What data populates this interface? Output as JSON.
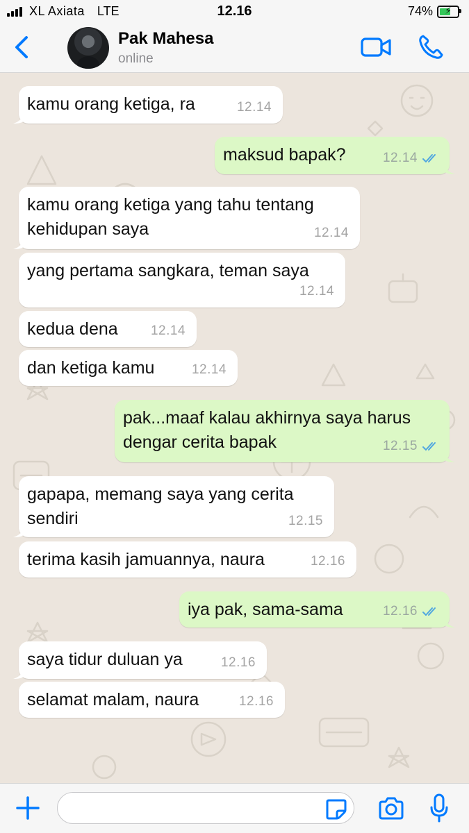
{
  "status_bar": {
    "carrier": "XL Axiata",
    "network": "LTE",
    "time": "12.16",
    "battery_text": "74%",
    "battery_level": 0.74
  },
  "header": {
    "back_icon": "chevron-left-icon",
    "contact_name": "Pak Mahesa",
    "contact_status": "online",
    "video_icon": "video-camera-icon",
    "call_icon": "phone-icon"
  },
  "messages": [
    {
      "direction": "in",
      "lines": [
        "kamu orang ketiga, ra"
      ],
      "time": "12.14"
    },
    {
      "direction": "out",
      "lines": [
        "maksud bapak?"
      ],
      "time": "12.14"
    },
    {
      "direction": "in",
      "lines": [
        "kamu orang ketiga yang tahu tentang",
        "kehidupan saya"
      ],
      "time": "12.14"
    },
    {
      "direction": "in",
      "lines": [
        "yang pertama sangkara, teman saya"
      ],
      "time": "12.14"
    },
    {
      "direction": "in",
      "lines": [
        "kedua dena"
      ],
      "time": "12.14"
    },
    {
      "direction": "in",
      "lines": [
        "dan ketiga kamu"
      ],
      "time": "12.14"
    },
    {
      "direction": "out",
      "lines": [
        "pak...maaf kalau akhirnya saya harus",
        "dengar cerita bapak"
      ],
      "time": "12.15"
    },
    {
      "direction": "in",
      "lines": [
        "gapapa, memang saya yang cerita",
        "sendiri"
      ],
      "time": "12.15"
    },
    {
      "direction": "in",
      "lines": [
        "terima kasih jamuannya, naura"
      ],
      "time": "12.16"
    },
    {
      "direction": "out",
      "lines": [
        "iya pak, sama-sama"
      ],
      "time": "12.16"
    },
    {
      "direction": "in",
      "lines": [
        "saya tidur duluan ya"
      ],
      "time": "12.16"
    },
    {
      "direction": "in",
      "lines": [
        "selamat malam, naura"
      ],
      "time": "12.16"
    }
  ],
  "input_bar": {
    "placeholder": "",
    "value": "",
    "icons": [
      "plus-icon",
      "sticker-icon",
      "camera-icon",
      "microphone-icon"
    ]
  },
  "colors": {
    "accent": "#007aff",
    "outgoing_bubble": "#dcf8c6",
    "incoming_bubble": "#ffffff",
    "read_ticks": "#4fa6e0",
    "chat_background": "#ece5dd"
  }
}
